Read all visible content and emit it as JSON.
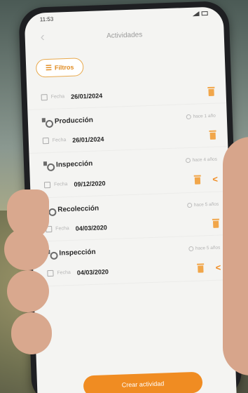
{
  "status": {
    "time": "11:53"
  },
  "header": {
    "title": "Actividades",
    "back_icon": "chevron-left-icon"
  },
  "filter": {
    "label": "Filtros",
    "icon": "filter-icon",
    "accent": "#f08c22"
  },
  "date_label": "Fecha",
  "activities": [
    {
      "title": "",
      "ago": "",
      "date": "26/01/2024",
      "share": false
    },
    {
      "title": "Producción",
      "ago": "hace 1 año",
      "date": "26/01/2024",
      "share": false
    },
    {
      "title": "Inspección",
      "ago": "hace 4 años",
      "date": "09/12/2020",
      "share": true
    },
    {
      "title": "Recolección",
      "ago": "hace 5 años",
      "date": "04/03/2020",
      "share": false
    },
    {
      "title": "Inspección",
      "ago": "hace 5 años",
      "date": "04/03/2020",
      "share": true
    }
  ],
  "create_button": {
    "label": "Crear actividad"
  }
}
